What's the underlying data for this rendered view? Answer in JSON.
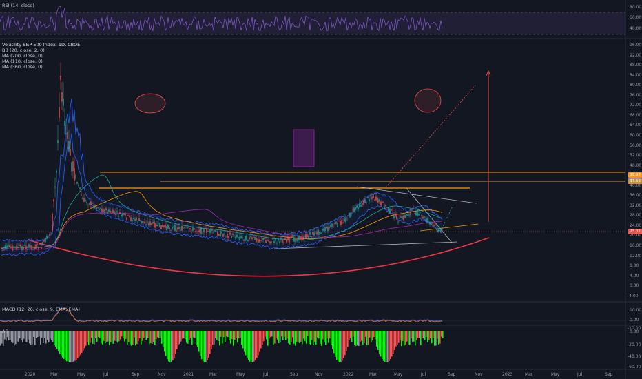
{
  "panes": {
    "rsi": {
      "label": "RSI (14, close)",
      "ticks": [
        "80.00",
        "60.00",
        "40.00"
      ]
    },
    "main": {
      "legend": [
        "Volatility S&P 500 Index, 1D, CBOE",
        "BB (20, close, 2, 0)",
        "MA (200, close, 0)",
        "MA (110, close, 0)",
        "MA (360, close, 0)"
      ],
      "ticks": [
        "96.00",
        "92.00",
        "88.00",
        "84.00",
        "80.00",
        "76.00",
        "72.00",
        "68.00",
        "64.00",
        "60.00",
        "56.00",
        "52.00",
        "48.00",
        "44.00",
        "40.00",
        "36.00",
        "32.00",
        "28.00",
        "24.00",
        "20.00",
        "16.00",
        "12.00",
        "8.00",
        "4.00",
        "0.00",
        "-4.00"
      ],
      "price_badges": [
        {
          "text": "39.92",
          "color": "#f7931a"
        },
        {
          "text": "37.59",
          "color": "#c8913f"
        },
        {
          "text": "23.02",
          "color": "#ef5350"
        }
      ]
    },
    "macd": {
      "label": "MACD (12, 26, close, 9, EMA, EMA)",
      "ticks": [
        "10.00",
        "0.00",
        "-10.00"
      ]
    },
    "ao": {
      "label": "AO",
      "ticks": [
        "0.00",
        "-20.00",
        "-40.00",
        "-60.00"
      ]
    }
  },
  "time_axis": [
    "2020",
    "Mar",
    "May",
    "Jul",
    "Sep",
    "Nov",
    "2021",
    "Mar",
    "May",
    "Jul",
    "Sep",
    "Nov",
    "2022",
    "Mar",
    "May",
    "Jul",
    "Sep",
    "Nov",
    "2023",
    "Mar",
    "May",
    "Jul",
    "Sep"
  ],
  "colors": {
    "background": "#131722",
    "rsi_line": "#7e57c2",
    "price_line": "#ef5350",
    "bollinger": "#2962ff",
    "ma_200": "#ff9800",
    "ma_110": "#26a69a",
    "ma_360": "#9c27b0",
    "resistance": "#ff9800",
    "curve": "#f23645",
    "ao_up": "#00ff00",
    "ao_down": "#ff5252",
    "ao_neutral": "#9598a1"
  }
}
